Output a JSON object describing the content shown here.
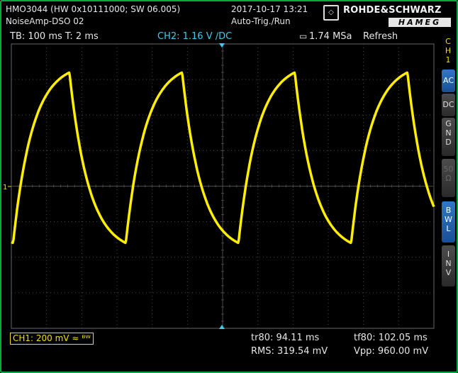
{
  "header": {
    "device": "HMO3044 (HW 0x10111000; SW 06.005)",
    "file": "NoiseAmp-DSO 02",
    "datetime": "2017-10-17 13:21",
    "trigger_mode": "Auto-Trig./Run"
  },
  "logo": {
    "brand": "ROHDE&SCHWARZ",
    "sub": "HAMEG"
  },
  "status": {
    "timebase": "TB: 100 ms  T: 2 ms",
    "trigger": "CH2: 1.16 V ∕DC",
    "sample_rate": "1.74 MSa",
    "acq_mode": "Refresh"
  },
  "sidebar": {
    "channel": "C\nH\n1",
    "buttons": [
      {
        "label": "AC",
        "state": "active"
      },
      {
        "label": "DC",
        "state": "normal"
      },
      {
        "label": "G\nN\nD",
        "state": "normal"
      },
      {
        "label": "50\nΩ",
        "state": "dim"
      },
      {
        "label": "B\nW\nL",
        "state": "active"
      },
      {
        "label": "I\nN\nV",
        "state": "normal"
      }
    ]
  },
  "bottom": {
    "ch1": "CH1: 200 mV ≈ ᴮᵂ",
    "tr80": "tr80: 94.11 ms",
    "tf80": "tf80: 102.05 ms",
    "rms": "RMS: 319.54 mV",
    "vpp": "Vpp: 960.00 mV"
  },
  "chart_data": {
    "type": "line",
    "title": "",
    "xlabel": "",
    "ylabel": "",
    "series": [
      {
        "waveform": "exponential charge/discharge (RC sawtooth)",
        "period_divisions": 3.2,
        "min_div": -1.6,
        "max_div": 3.2,
        "rise_time_div": 1.6,
        "fall_time_div": 1.6,
        "color": "#ffee00"
      }
    ],
    "grid": {
      "horizontal_divisions": 12,
      "vertical_divisions": 8
    },
    "colors": {
      "trace": "#ffee00",
      "grid": "#555555",
      "accent": "#48c8e8"
    }
  }
}
